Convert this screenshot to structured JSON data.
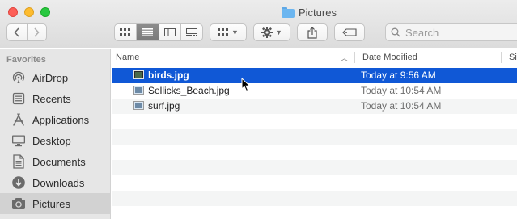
{
  "window": {
    "title": "Pictures"
  },
  "toolbar": {
    "back_icon": "chevron-left-icon",
    "forward_icon": "chevron-right-icon",
    "search_placeholder": "Search"
  },
  "sidebar": {
    "header": "Favorites",
    "items": [
      {
        "label": "AirDrop",
        "icon": "airdrop-icon"
      },
      {
        "label": "Recents",
        "icon": "recents-icon"
      },
      {
        "label": "Applications",
        "icon": "applications-icon"
      },
      {
        "label": "Desktop",
        "icon": "desktop-icon"
      },
      {
        "label": "Documents",
        "icon": "documents-icon"
      },
      {
        "label": "Downloads",
        "icon": "downloads-icon"
      },
      {
        "label": "Pictures",
        "icon": "pictures-icon",
        "selected": true
      }
    ]
  },
  "list": {
    "columns": {
      "name": "Name",
      "date": "Date Modified",
      "size": "Si"
    },
    "files": [
      {
        "name": "birds.jpg",
        "date": "Today at 9:56 AM",
        "selected": true
      },
      {
        "name": "Sellicks_Beach.jpg",
        "date": "Today at 10:54 AM"
      },
      {
        "name": "surf.jpg",
        "date": "Today at 10:54 AM"
      }
    ]
  },
  "colors": {
    "selection": "#1058d6",
    "sidebar_bg": "#e6e6e6"
  }
}
